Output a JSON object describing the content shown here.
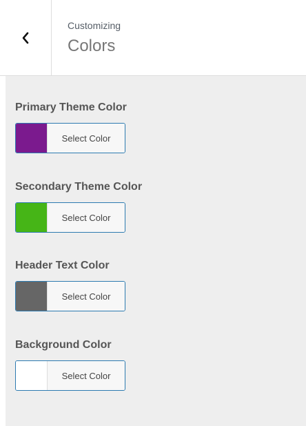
{
  "header": {
    "subtitle": "Customizing",
    "title": "Colors"
  },
  "controls": [
    {
      "label": "Primary Theme Color",
      "button_label": "Select Color",
      "color": "#7b1a8e"
    },
    {
      "label": "Secondary Theme Color",
      "button_label": "Select Color",
      "color": "#46b517"
    },
    {
      "label": "Header Text Color",
      "button_label": "Select Color",
      "color": "#666666"
    },
    {
      "label": "Background Color",
      "button_label": "Select Color",
      "color": "#ffffff"
    }
  ]
}
